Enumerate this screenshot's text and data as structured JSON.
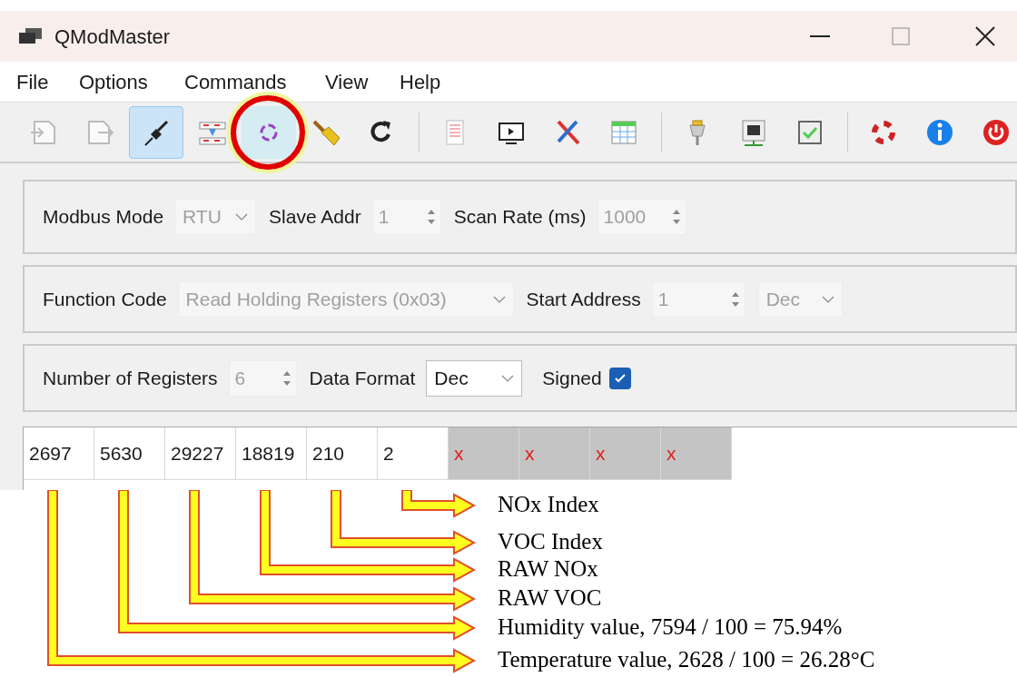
{
  "window": {
    "title": "QModMaster"
  },
  "menu": [
    "File",
    "Options",
    "Commands",
    "View",
    "Help"
  ],
  "toolbar": {
    "buttons": [
      {
        "checked": false,
        "annotated": false
      },
      {
        "checked": false,
        "annotated": false
      },
      {
        "checked": true,
        "annotated": false
      },
      {
        "checked": false,
        "annotated": false
      },
      {
        "checked": false,
        "annotated": true
      },
      {
        "checked": false,
        "annotated": false
      },
      {
        "checked": false,
        "annotated": false
      },
      {
        "checked": false,
        "annotated": false
      },
      {
        "checked": false,
        "annotated": false
      },
      {
        "checked": false,
        "annotated": false
      },
      {
        "checked": false,
        "annotated": false
      },
      {
        "checked": false,
        "annotated": false
      },
      {
        "checked": false,
        "annotated": false
      },
      {
        "checked": false,
        "annotated": false
      },
      {
        "checked": false,
        "annotated": false
      },
      {
        "checked": false,
        "annotated": false
      },
      {
        "checked": false,
        "annotated": false
      }
    ]
  },
  "groups": [
    {
      "fields": [
        {
          "kind": "combo",
          "label": "Modbus Mode",
          "value": "RTU",
          "disabled": true
        },
        {
          "kind": "spin",
          "label": "Slave Addr",
          "value": "1",
          "disabled": true
        },
        {
          "kind": "spin",
          "label": "Scan Rate (ms)",
          "value": "1000",
          "disabled": true
        }
      ]
    },
    {
      "fields": [
        {
          "kind": "combo",
          "label": "Function Code",
          "value": "Read Holding Registers (0x03)",
          "disabled": true
        },
        {
          "kind": "spin",
          "label": "Start Address",
          "value": "1",
          "disabled": true
        },
        {
          "kind": "combo",
          "value": "Dec",
          "disabled": true
        }
      ]
    },
    {
      "fields": [
        {
          "kind": "spin",
          "label": "Number of Registers",
          "value": "6",
          "disabled": true
        },
        {
          "kind": "combo",
          "label": "Data Format",
          "value": "Dec",
          "disabled": false
        },
        {
          "kind": "check",
          "label": "Signed",
          "checked": true
        }
      ]
    }
  ],
  "registers": [
    {
      "value": "2697",
      "valid": true
    },
    {
      "value": "5630",
      "valid": true
    },
    {
      "value": "29227",
      "valid": true
    },
    {
      "value": "18819",
      "valid": true
    },
    {
      "value": "210",
      "valid": true
    },
    {
      "value": "2",
      "valid": true
    },
    {
      "value": "x",
      "valid": false
    },
    {
      "value": "x",
      "valid": false
    },
    {
      "value": "x",
      "valid": false
    },
    {
      "value": "x",
      "valid": false
    }
  ],
  "annotations": [
    "NOx Index",
    "VOC Index",
    "RAW NOx",
    "RAW VOC",
    "Humidity value, 7594 / 100 = 75.94%",
    "Temperature value, 2628 / 100 = 26.28°C"
  ]
}
